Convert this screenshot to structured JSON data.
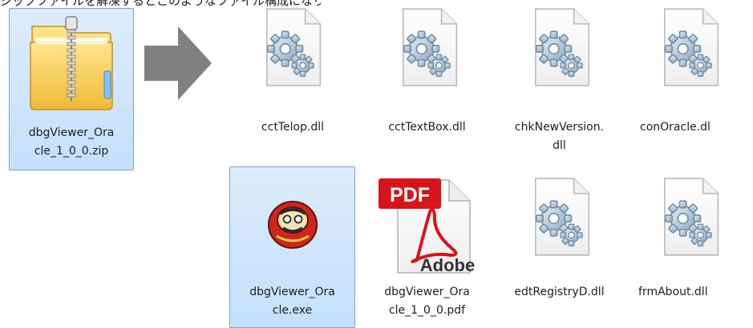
{
  "caption": "ジップファイルを解凍するとこのようなファイル構成になります。",
  "source_file": {
    "name_line1": "dbgViewer_Ora",
    "name_line2": "cle_1_0_0.zip",
    "icon": "zip-folder-icon"
  },
  "arrow_icon": "right-arrow-icon",
  "files": [
    {
      "line1": "cctTelop.dll",
      "line2": "",
      "icon": "dll-gear-icon",
      "selected": false
    },
    {
      "line1": "cctTextBox.dll",
      "line2": "",
      "icon": "dll-gear-icon",
      "selected": false
    },
    {
      "line1": "chkNewVersion.",
      "line2": "dll",
      "icon": "dll-gear-icon",
      "selected": false
    },
    {
      "line1": "conOracle.dl",
      "line2": "",
      "icon": "dll-gear-icon",
      "selected": false
    },
    {
      "line1": "dbgViewer_Ora",
      "line2": "cle.exe",
      "icon": "daruma-app-icon",
      "selected": true
    },
    {
      "line1": "dbgViewer_Ora",
      "line2": "cle_1_0_0.pdf",
      "icon": "pdf-adobe-icon",
      "selected": false
    },
    {
      "line1": "edtRegistryD.dll",
      "line2": "",
      "icon": "dll-gear-icon",
      "selected": false
    },
    {
      "line1": "frmAbout.dll",
      "line2": "",
      "icon": "dll-gear-icon",
      "selected": false
    }
  ],
  "colors": {
    "selection": "#cde8ff",
    "selection_border": "#7da2ce",
    "arrow": "#808080",
    "pdf_red": "#d8131a"
  }
}
